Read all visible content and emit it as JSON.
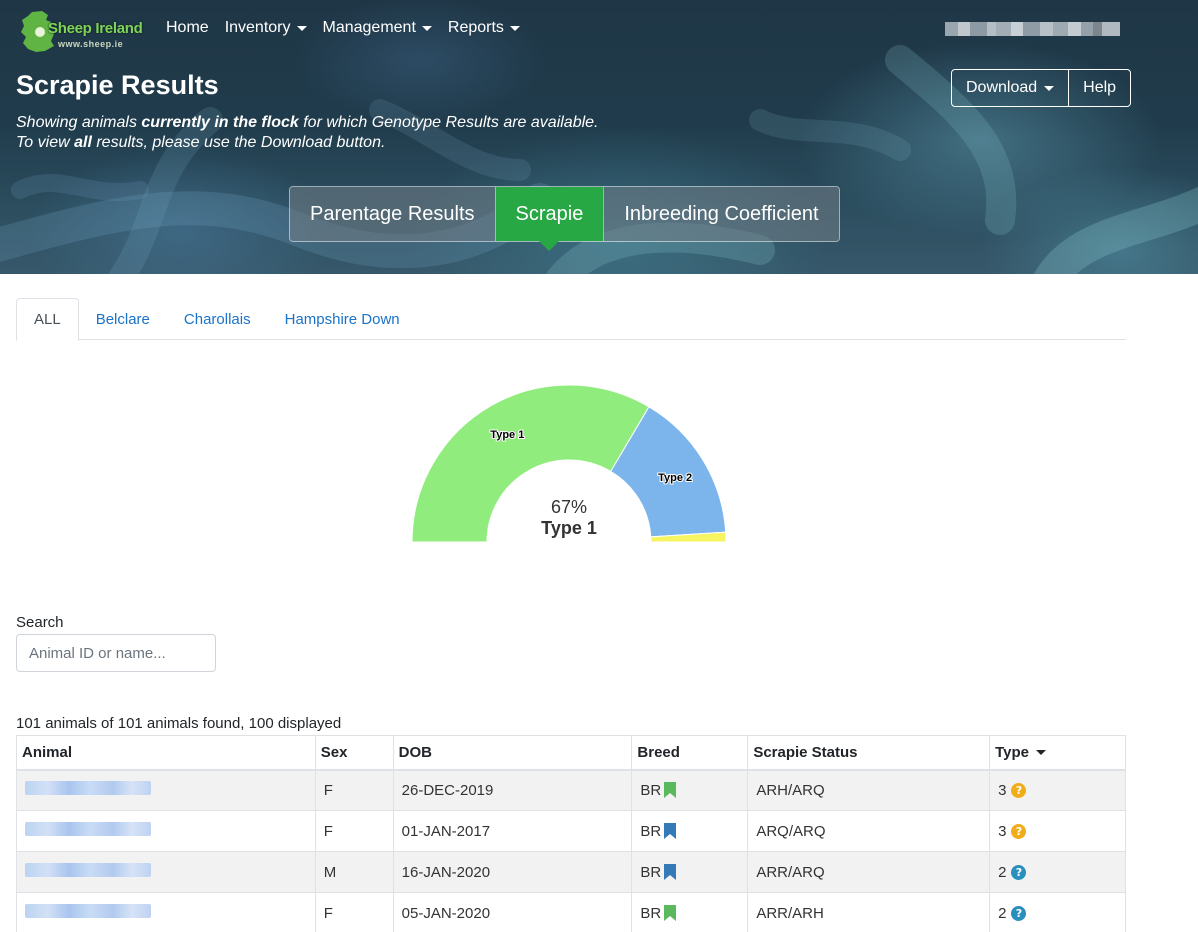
{
  "header": {
    "logo_name": "Sheep Ireland",
    "logo_url": "www.sheep.ie",
    "nav": [
      {
        "label": "Home",
        "dropdown": false
      },
      {
        "label": "Inventory",
        "dropdown": true
      },
      {
        "label": "Management",
        "dropdown": true
      },
      {
        "label": "Reports",
        "dropdown": true
      }
    ],
    "user_name_obscured": true
  },
  "hero": {
    "title": "Scrapie Results",
    "subtitle_line1_pre": "Showing animals ",
    "subtitle_line1_bold": "currently in the flock",
    "subtitle_line1_post": " for which Genotype Results are available.",
    "subtitle_line2_pre": "To view ",
    "subtitle_line2_bold": "all",
    "subtitle_line2_post": " results, please use the Download button.",
    "download_label": "Download",
    "help_label": "Help",
    "pill_tabs": [
      {
        "label": "Parentage Results",
        "active": false
      },
      {
        "label": "Scrapie",
        "active": true
      },
      {
        "label": "Inbreeding Coefficient",
        "active": false
      }
    ]
  },
  "breed_tabs": [
    {
      "label": "ALL",
      "active": true
    },
    {
      "label": "Belclare",
      "active": false
    },
    {
      "label": "Charollais",
      "active": false
    },
    {
      "label": "Hampshire Down",
      "active": false
    }
  ],
  "chart_data": {
    "type": "pie",
    "variant": "semi-donut gauge",
    "slices": [
      {
        "label": "Type 1",
        "value": 67,
        "color": "#90ed7d"
      },
      {
        "label": "Type 2",
        "value": 31,
        "color": "#7cb5ec"
      },
      {
        "label": "",
        "value": 2,
        "color": "#f7f461"
      }
    ],
    "center_percent": "67%",
    "center_label": "Type 1"
  },
  "search": {
    "label": "Search",
    "placeholder": "Animal ID or name..."
  },
  "results_summary": "101 animals of 101 animals found, 100 displayed",
  "table": {
    "columns": [
      "Animal",
      "Sex",
      "DOB",
      "Breed",
      "Scrapie Status",
      "Type"
    ],
    "sorted_column": "Type",
    "rows": [
      {
        "sex": "F",
        "dob": "26-DEC-2019",
        "breed": "BR",
        "breed_flag_color": "#5cb85c",
        "status": "ARH/ARQ",
        "type": "3",
        "type_icon_color": "#f0ad1b"
      },
      {
        "sex": "F",
        "dob": "01-JAN-2017",
        "breed": "BR",
        "breed_flag_color": "#337ab7",
        "status": "ARQ/ARQ",
        "type": "3",
        "type_icon_color": "#f0ad1b"
      },
      {
        "sex": "M",
        "dob": "16-JAN-2020",
        "breed": "BR",
        "breed_flag_color": "#337ab7",
        "status": "ARR/ARQ",
        "type": "2",
        "type_icon_color": "#2a8fbd"
      },
      {
        "sex": "F",
        "dob": "05-JAN-2020",
        "breed": "BR",
        "breed_flag_color": "#5cb85c",
        "status": "ARR/ARH",
        "type": "2",
        "type_icon_color": "#2a8fbd"
      }
    ]
  }
}
